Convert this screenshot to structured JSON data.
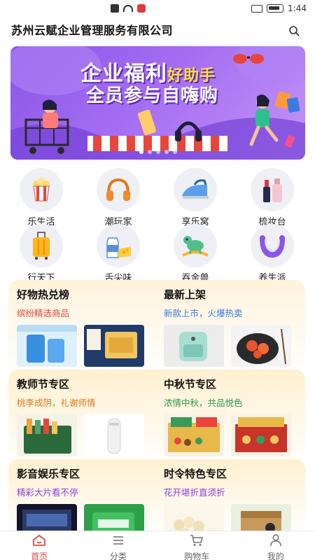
{
  "status_bar": {
    "time": "1:44",
    "icons": [
      "alert-icon",
      "wifi-icon",
      "app-notification-icon",
      "vibrate-icon",
      "battery-icon"
    ]
  },
  "header": {
    "title": "苏州云赋企业管理服务有限公司",
    "search_icon": "search-icon"
  },
  "banner": {
    "line1_main": "企业福利",
    "line1_accent": "好助手",
    "line2": "全员参与自嗨购",
    "slide_count": 5,
    "active_slide": 1
  },
  "categories": [
    {
      "label": "乐生活",
      "icon": "popcorn-icon"
    },
    {
      "label": "潮玩家",
      "icon": "headphones-icon"
    },
    {
      "label": "享乐窝",
      "icon": "steam-iron-icon"
    },
    {
      "label": "梳妆台",
      "icon": "cosmetics-bottle-icon"
    },
    {
      "label": "行天下",
      "icon": "suitcase-icon"
    },
    {
      "label": "舌尖味",
      "icon": "milk-cheese-icon"
    },
    {
      "label": "吞金兽",
      "icon": "toy-horse-icon"
    },
    {
      "label": "养生派",
      "icon": "neck-massager-icon"
    }
  ],
  "sections": [
    {
      "title": "好物热兑榜",
      "subtitle": "缤纷精选商品"
    },
    {
      "title": "最新上架",
      "subtitle": "新款上市，火爆热卖"
    },
    {
      "title": "教师节专区",
      "subtitle": "桃李成阴，礼谢师情"
    },
    {
      "title": "中秋节专区",
      "subtitle": "浓情中秋，共品悦色"
    },
    {
      "title": "影音娱乐专区",
      "subtitle": "精彩大片看不停"
    },
    {
      "title": "时令特色专区",
      "subtitle": "花开堪折直须折"
    }
  ],
  "tabs": [
    {
      "label": "首页",
      "icon": "home-icon",
      "active": true
    },
    {
      "label": "分类",
      "icon": "category-list-icon",
      "active": false
    },
    {
      "label": "购物车",
      "icon": "shopping-cart-icon",
      "active": false
    },
    {
      "label": "我的",
      "icon": "user-icon",
      "active": false
    }
  ],
  "colors": {
    "accent": "#e8453c",
    "banner_purple": "#8a55e8",
    "subtitle_red": "#e8453c",
    "subtitle_green": "#2a9a4a",
    "subtitle_blue": "#3a7be0",
    "subtitle_orange": "#e07a1a",
    "subtitle_purple": "#8a3ee0"
  }
}
